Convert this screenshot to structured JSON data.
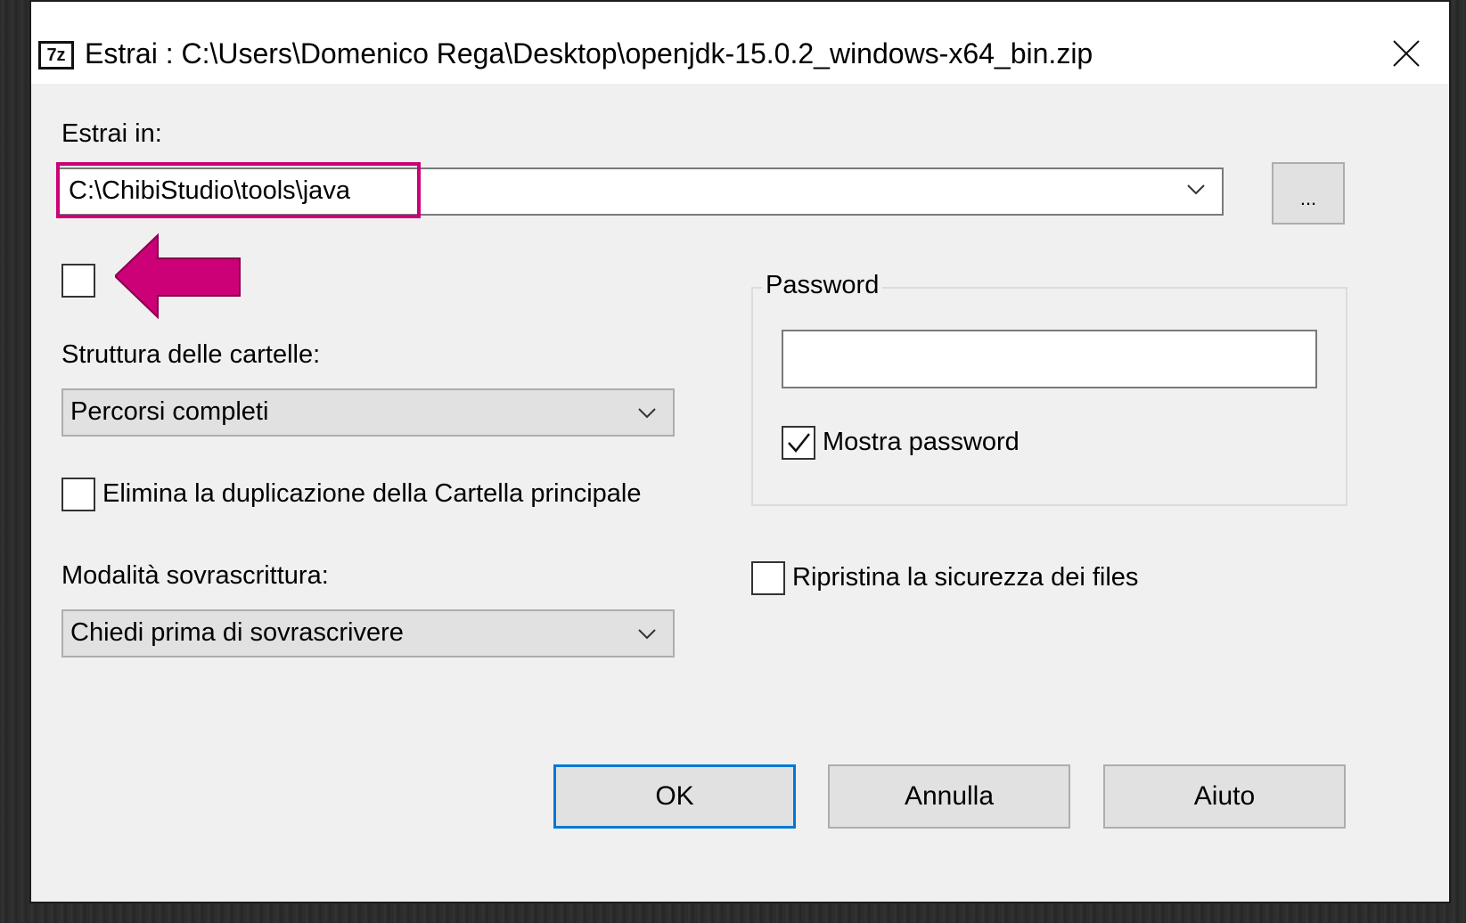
{
  "window": {
    "title": "Estrai : C:\\Users\\Domenico Rega\\Desktop\\openjdk-15.0.2_windows-x64_bin.zip",
    "app_icon_text": "7z"
  },
  "extract_to": {
    "label": "Estrai in:",
    "value": "C:\\ChibiStudio\\tools\\java",
    "browse_label": "..."
  },
  "folder_structure": {
    "label": "Struttura delle cartelle:",
    "selected": "Percorsi completi"
  },
  "eliminate_duplication": {
    "label": "Elimina la duplicazione della Cartella principale",
    "checked": false
  },
  "overwrite_mode": {
    "label": "Modalità sovrascrittura:",
    "selected": "Chiedi prima di sovrascrivere"
  },
  "password_group": {
    "title": "Password",
    "value": "",
    "show_password_label": "Mostra password",
    "show_password_checked": true
  },
  "restore_security": {
    "label": "Ripristina la sicurezza dei files",
    "checked": false
  },
  "buttons": {
    "ok": "OK",
    "cancel": "Annulla",
    "help": "Aiuto"
  },
  "annotation": {
    "highlight_color": "#cc0077",
    "arrow_color": "#cc0077"
  }
}
